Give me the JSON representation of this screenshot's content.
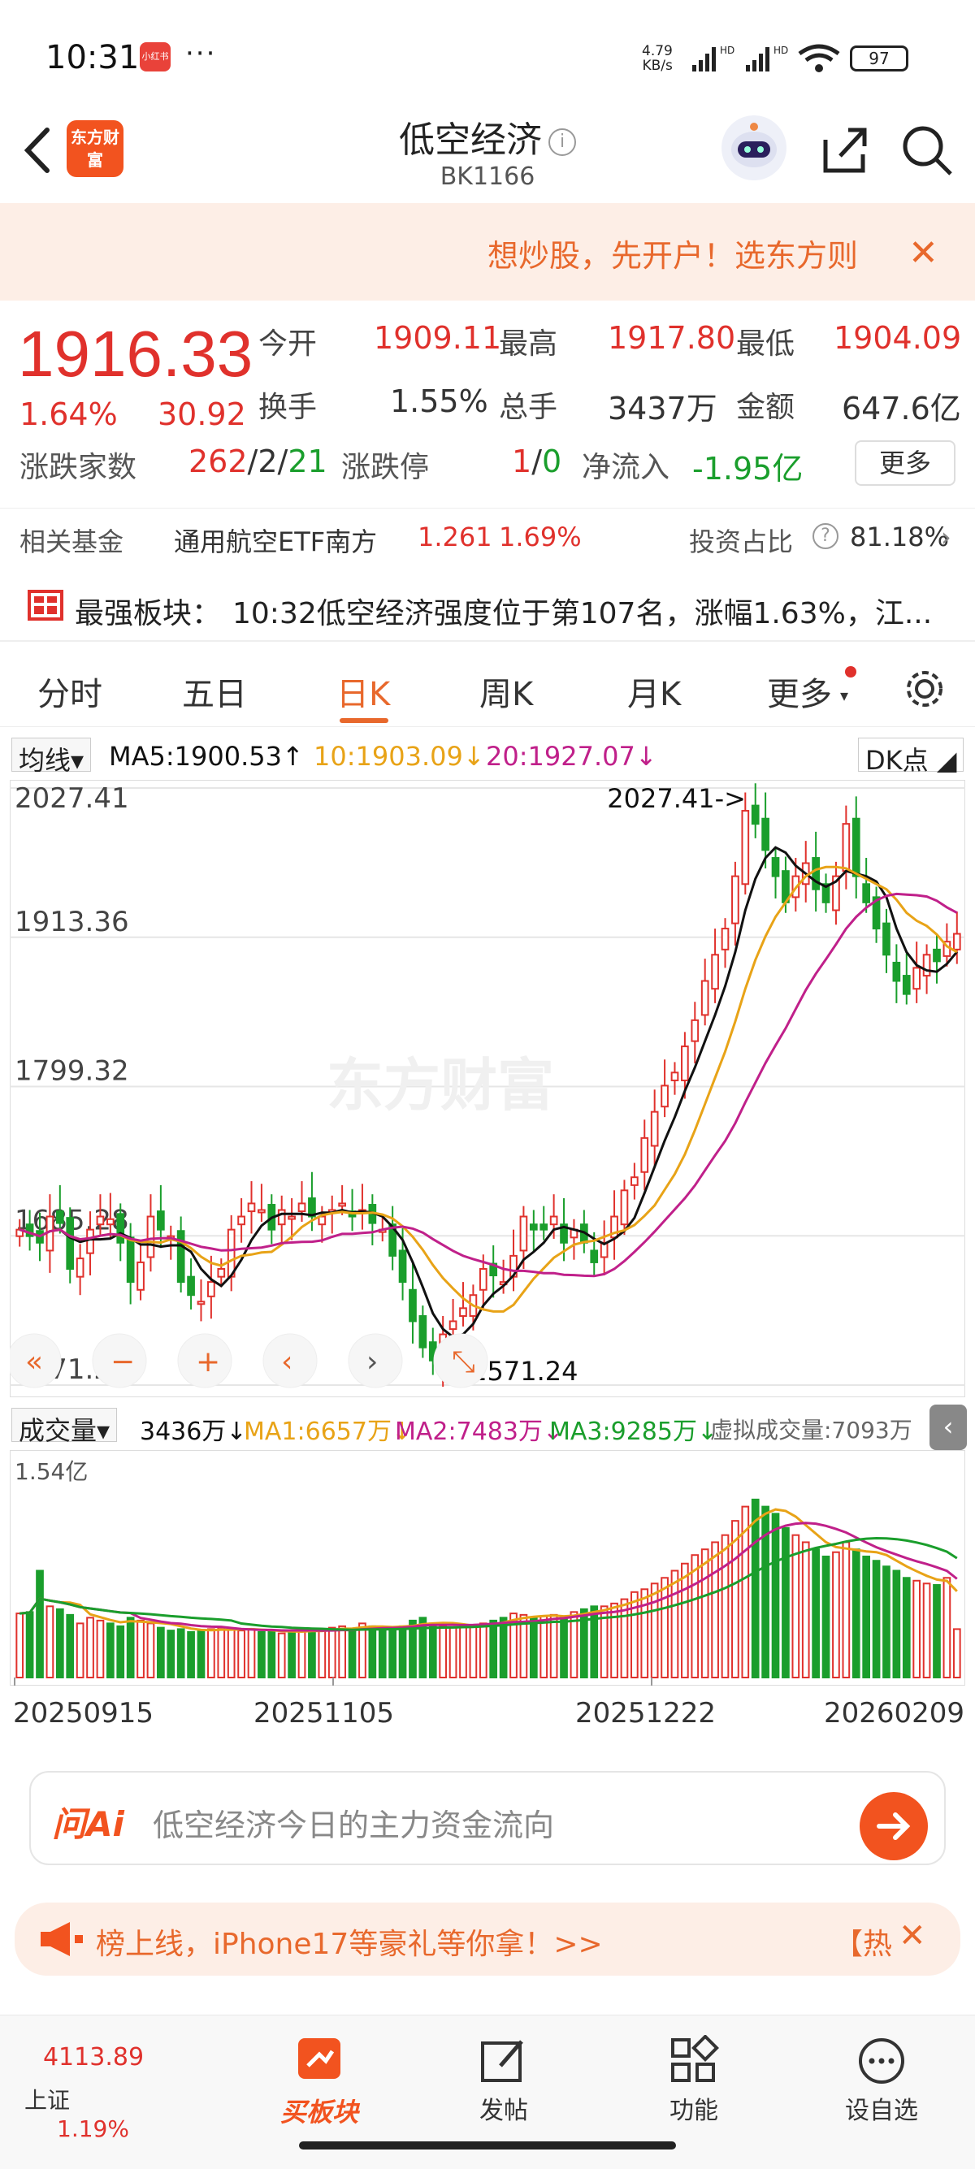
{
  "status_bar": {
    "time": "10:31",
    "app_badge": "小红书",
    "dots": "···",
    "net_speed": "4.79",
    "net_unit": "KB/s",
    "battery": "97"
  },
  "header": {
    "logo_text": "东方财富",
    "title": "低空经济",
    "info": "i",
    "code": "BK1166"
  },
  "promo": {
    "text": "想炒股，先开户！选东方则",
    "close": "✕"
  },
  "quote": {
    "price": "1916.33",
    "change_pct": "1.64%",
    "change": "30.92",
    "open_label": "今开",
    "open": "1909.11",
    "high_label": "最高",
    "high": "1917.80",
    "low_label": "最低",
    "low": "1904.09",
    "turnover_label": "换手",
    "turnover": "1.55%",
    "volume_label": "总手",
    "volume": "3437万",
    "amount_label": "金额",
    "amount": "647.6亿",
    "breadth_label": "涨跌家数",
    "breadth_up": "262",
    "breadth_flat": "/2/",
    "breadth_down": "21",
    "limit_label": "涨跌停",
    "limit_up": "1",
    "limit_sep": "/",
    "limit_down": "0",
    "netflow_label": "净流入",
    "netflow": "-1.95亿",
    "more": "更多"
  },
  "fund": {
    "label": "相关基金",
    "name": "通用航空ETF南方",
    "price": "1.261",
    "pct": "1.69%",
    "ratio_label": "投资占比",
    "ratio": "81.18%",
    "chevron": "›"
  },
  "strongest": {
    "label": "最强板块：",
    "text": "10:32低空经济强度位于第107名，涨幅1.63%，江..."
  },
  "tabs": [
    "分时",
    "五日",
    "日K",
    "周K",
    "月K",
    "更多"
  ],
  "ma": {
    "selector": "均线",
    "ma5": "MA5:1900.53",
    "ma10": "10:1903.09",
    "ma20": "20:1927.07",
    "dk": "DK点"
  },
  "chart_data": {
    "type": "candlestick",
    "y_ticks": [
      "2027.41",
      "1913.36",
      "1799.32",
      "1685.28",
      "1571.24"
    ],
    "ylim": [
      1571.24,
      2027.41
    ],
    "max_label": "2027.41->",
    "min_label": "<-1571.24",
    "watermark": "东方财富",
    "x_ticks": [
      "20250915",
      "20251105",
      "20251222",
      "20260209"
    ],
    "close": [
      1690,
      1685,
      1680,
      1700,
      1695,
      1660,
      1668,
      1690,
      1700,
      1698,
      1680,
      1650,
      1665,
      1700,
      1690,
      1685,
      1650,
      1640,
      1635,
      1650,
      1660,
      1690,
      1700,
      1710,
      1705,
      1690,
      1705,
      1700,
      1710,
      1700,
      1700,
      1705,
      1710,
      1700,
      1705,
      1695,
      1690,
      1670,
      1650,
      1620,
      1600,
      1590,
      1610,
      1620,
      1630,
      1640,
      1660,
      1655,
      1650,
      1670,
      1700,
      1690,
      1690,
      1700,
      1680,
      1690,
      1680,
      1665,
      1680,
      1700,
      1720,
      1730,
      1760,
      1780,
      1800,
      1810,
      1830,
      1850,
      1880,
      1900,
      1920,
      1960,
      2010,
      2000,
      1980,
      1960,
      1940,
      1960,
      1970,
      1950,
      1940,
      1960,
      2000,
      1960,
      1940,
      1920,
      1900,
      1880,
      1870,
      1890,
      1900,
      1895,
      1910,
      1916
    ],
    "ma5_label": "MA5",
    "ma10_label": "MA10",
    "ma20_label": "MA20"
  },
  "volume": {
    "selector": "成交量",
    "current": "3436万",
    "ma1": "MA1:6657万",
    "ma2": "MA2:7483万",
    "ma3": "MA3:9285万",
    "virtual": "虚拟成交量:7093万",
    "y_max": "1.54亿",
    "values": [
      0.45,
      0.46,
      0.75,
      0.5,
      0.48,
      0.44,
      0.38,
      0.42,
      0.4,
      0.38,
      0.36,
      0.42,
      0.4,
      0.38,
      0.35,
      0.33,
      0.34,
      0.32,
      0.33,
      0.34,
      0.35,
      0.34,
      0.33,
      0.34,
      0.32,
      0.33,
      0.31,
      0.32,
      0.33,
      0.34,
      0.33,
      0.35,
      0.36,
      0.34,
      0.38,
      0.36,
      0.35,
      0.34,
      0.36,
      0.4,
      0.42,
      0.38,
      0.36,
      0.35,
      0.36,
      0.37,
      0.38,
      0.4,
      0.42,
      0.45,
      0.44,
      0.42,
      0.43,
      0.44,
      0.42,
      0.46,
      0.48,
      0.5,
      0.5,
      0.52,
      0.55,
      0.6,
      0.62,
      0.66,
      0.7,
      0.75,
      0.8,
      0.86,
      0.9,
      0.95,
      1.0,
      1.1,
      1.2,
      1.25,
      1.2,
      1.15,
      1.05,
      1.0,
      0.95,
      0.9,
      0.85,
      0.88,
      0.95,
      0.9,
      0.85,
      0.82,
      0.78,
      0.75,
      0.7,
      0.68,
      0.66,
      0.65,
      0.7,
      0.34
    ]
  },
  "ask_ai": {
    "logo": "问Ai",
    "placeholder": "低空经济今日的主力资金流向"
  },
  "notice": {
    "text": "榜上线，iPhone17等豪礼等你拿！>>",
    "tag": "【热",
    "close": "✕"
  },
  "bottom_nav": {
    "index_value": "4113.89",
    "index_name": "上证",
    "index_pct": "1.19%",
    "buy_block": "买板块",
    "post": "发帖",
    "functions": "功能",
    "set_watch": "设自选"
  },
  "colors": {
    "up": "#e0312c",
    "down": "#1a9e2c",
    "accent": "#f2531f",
    "ma5": "#111111",
    "ma10": "#e8a317",
    "ma20": "#c0208a"
  }
}
